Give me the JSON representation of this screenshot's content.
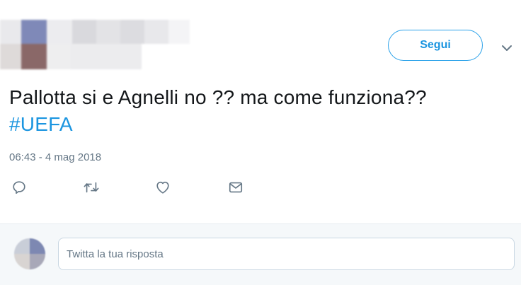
{
  "follow_button": {
    "label": "Segui",
    "color": "#1b95e0"
  },
  "tweet": {
    "text": "Pallotta si e Agnelli no ?? ma come funziona?? ",
    "hashtag": "#UEFA",
    "timestamp": "06:43 - 4 mag 2018"
  },
  "actions": [
    {
      "name": "reply",
      "icon": "reply-icon"
    },
    {
      "name": "retweet",
      "icon": "retweet-icon"
    },
    {
      "name": "like",
      "icon": "heart-icon"
    },
    {
      "name": "direct-message",
      "icon": "envelope-icon"
    }
  ],
  "reply": {
    "placeholder": "Twitta la tua risposta"
  },
  "colors": {
    "accent": "#1b95e0",
    "muted_text": "#657786",
    "reply_bg": "#f5f8fa"
  }
}
